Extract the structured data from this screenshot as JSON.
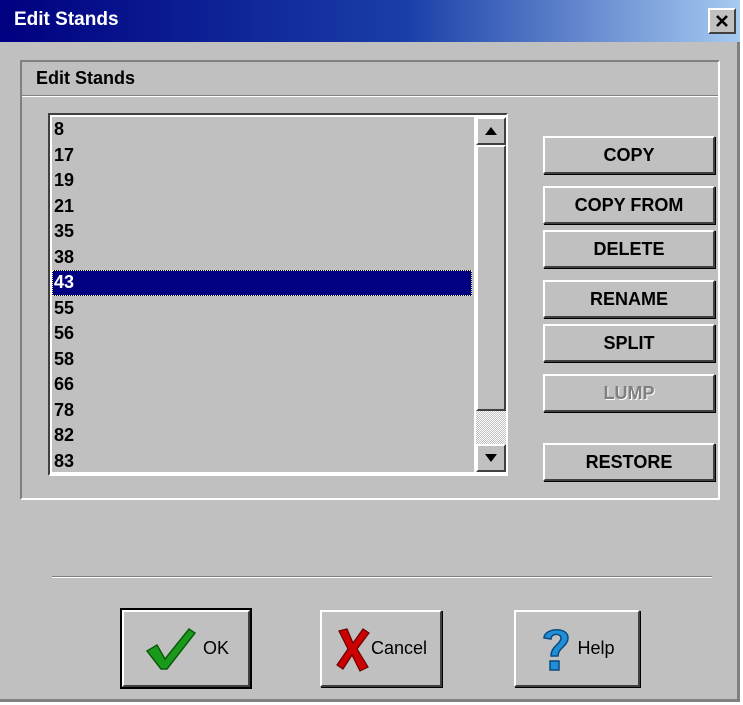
{
  "window": {
    "title": "Edit Stands",
    "close_symbol": "✕"
  },
  "group": {
    "label": "Edit Stands"
  },
  "stands": {
    "items": [
      "8",
      "17",
      "19",
      "21",
      "35",
      "38",
      "43",
      "55",
      "56",
      "58",
      "66",
      "78",
      "82",
      "83"
    ],
    "selected": "43"
  },
  "side_buttons": [
    {
      "label": "COPY",
      "enabled": true
    },
    {
      "label": "COPY FROM",
      "enabled": true
    },
    {
      "label": "DELETE",
      "enabled": true
    },
    {
      "label": "RENAME",
      "enabled": true
    },
    {
      "label": "SPLIT",
      "enabled": true
    },
    {
      "label": "LUMP",
      "enabled": false
    },
    {
      "label": "RESTORE",
      "enabled": true
    }
  ],
  "footer": {
    "ok_label": "OK",
    "cancel_label": "Cancel",
    "help_label": "Help"
  },
  "icons": {
    "ok": "checkmark-icon",
    "cancel": "x-cross-icon",
    "help": "question-mark-icon"
  },
  "colors": {
    "selection": "#000080",
    "ok_check": "#1a9a1a",
    "cancel_x": "#cc0000",
    "help_q": "#1f8fd8"
  }
}
